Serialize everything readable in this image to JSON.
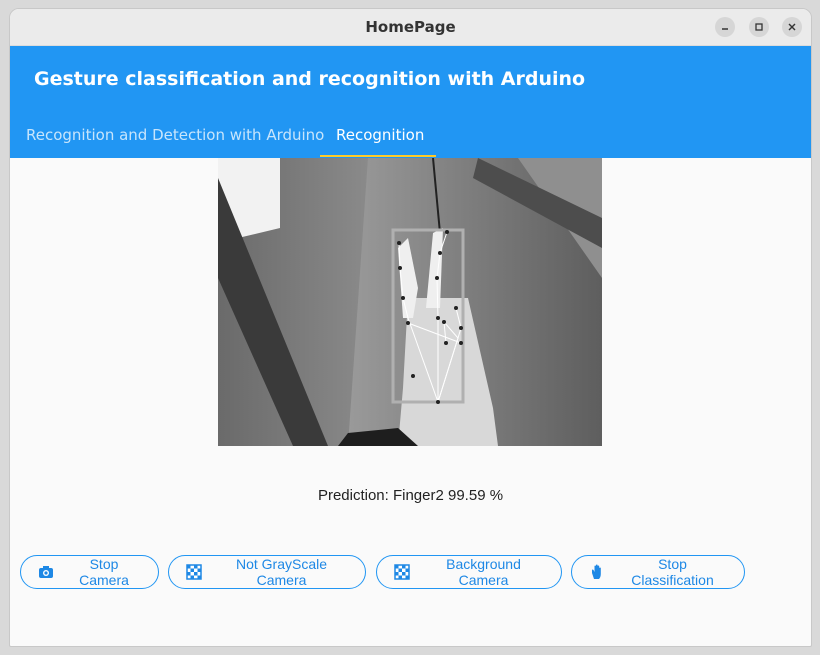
{
  "window": {
    "title": "HomePage"
  },
  "appbar": {
    "title": "Gesture classification and recognition with Arduino"
  },
  "tabs": [
    {
      "label": "Recognition and Detection with Arduino",
      "active": false
    },
    {
      "label": "Recognition",
      "active": true
    }
  ],
  "prediction": {
    "text": "Prediction: Finger2 99.59 %"
  },
  "buttons": {
    "stop_camera": "Stop Camera",
    "not_grayscale": "Not GrayScale Camera",
    "background_camera": "Background Camera",
    "stop_classification": "Stop Classification"
  },
  "colors": {
    "accent": "#2196f3",
    "tab_indicator": "#ffca28"
  }
}
